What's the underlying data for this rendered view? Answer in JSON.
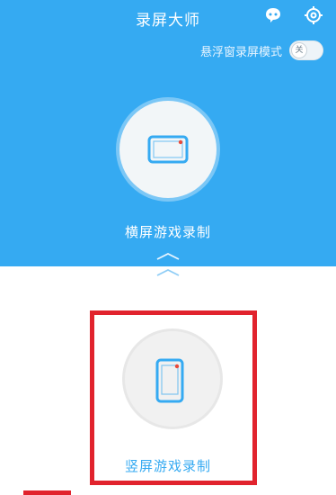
{
  "app": {
    "title": "录屏大师"
  },
  "header": {
    "feedback_icon": "feedback-chat-icon",
    "settings_icon": "gear-icon"
  },
  "floating_mode": {
    "label": "悬浮窗录屏模式",
    "toggle_text": "关",
    "enabled": false
  },
  "modes": {
    "landscape": {
      "label": "横屏游戏录制",
      "icon": "landscape-phone-icon"
    },
    "portrait": {
      "label": "竖屏游戏录制",
      "icon": "portrait-phone-icon"
    }
  },
  "colors": {
    "primary": "#35aaf2",
    "phone_icon": "#35aaf2",
    "record_dot": "#e84a3a",
    "highlight": "#e1232d"
  }
}
